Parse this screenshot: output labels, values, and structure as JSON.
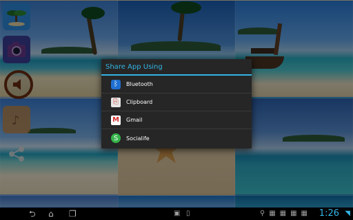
{
  "dialog": {
    "title": "Share App Using",
    "items": [
      {
        "label": "Bluetooth",
        "icon": "bluetooth-icon"
      },
      {
        "label": "Clipboard",
        "icon": "clipboard-icon"
      },
      {
        "label": "Gmail",
        "icon": "gmail-icon"
      },
      {
        "label": "Socialife",
        "icon": "socialife-icon"
      }
    ]
  },
  "status_bar": {
    "time": "1:26"
  },
  "colors": {
    "accent": "#33b5e5",
    "dialog_bg": "#262626"
  }
}
